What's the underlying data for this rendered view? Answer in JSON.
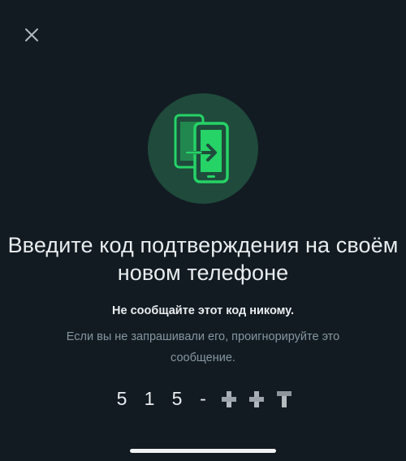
{
  "screen": {
    "title": "Введите код подтверждения на своём новом телефоне",
    "warning": "Не сообщайте этот код никому.",
    "hint": "Если вы не запрашивали его, проигнорируйте это сообщение."
  },
  "code": {
    "digits": [
      "5",
      "1",
      "5"
    ],
    "separator": "-",
    "masked_count": 3
  },
  "icons": {
    "close": "close-icon",
    "hero": "phone-transfer-icon"
  },
  "colors": {
    "background": "#121b22",
    "accent": "#25d366",
    "hero_circle": "#1f4a3c",
    "secondary_text": "#8696a0"
  }
}
